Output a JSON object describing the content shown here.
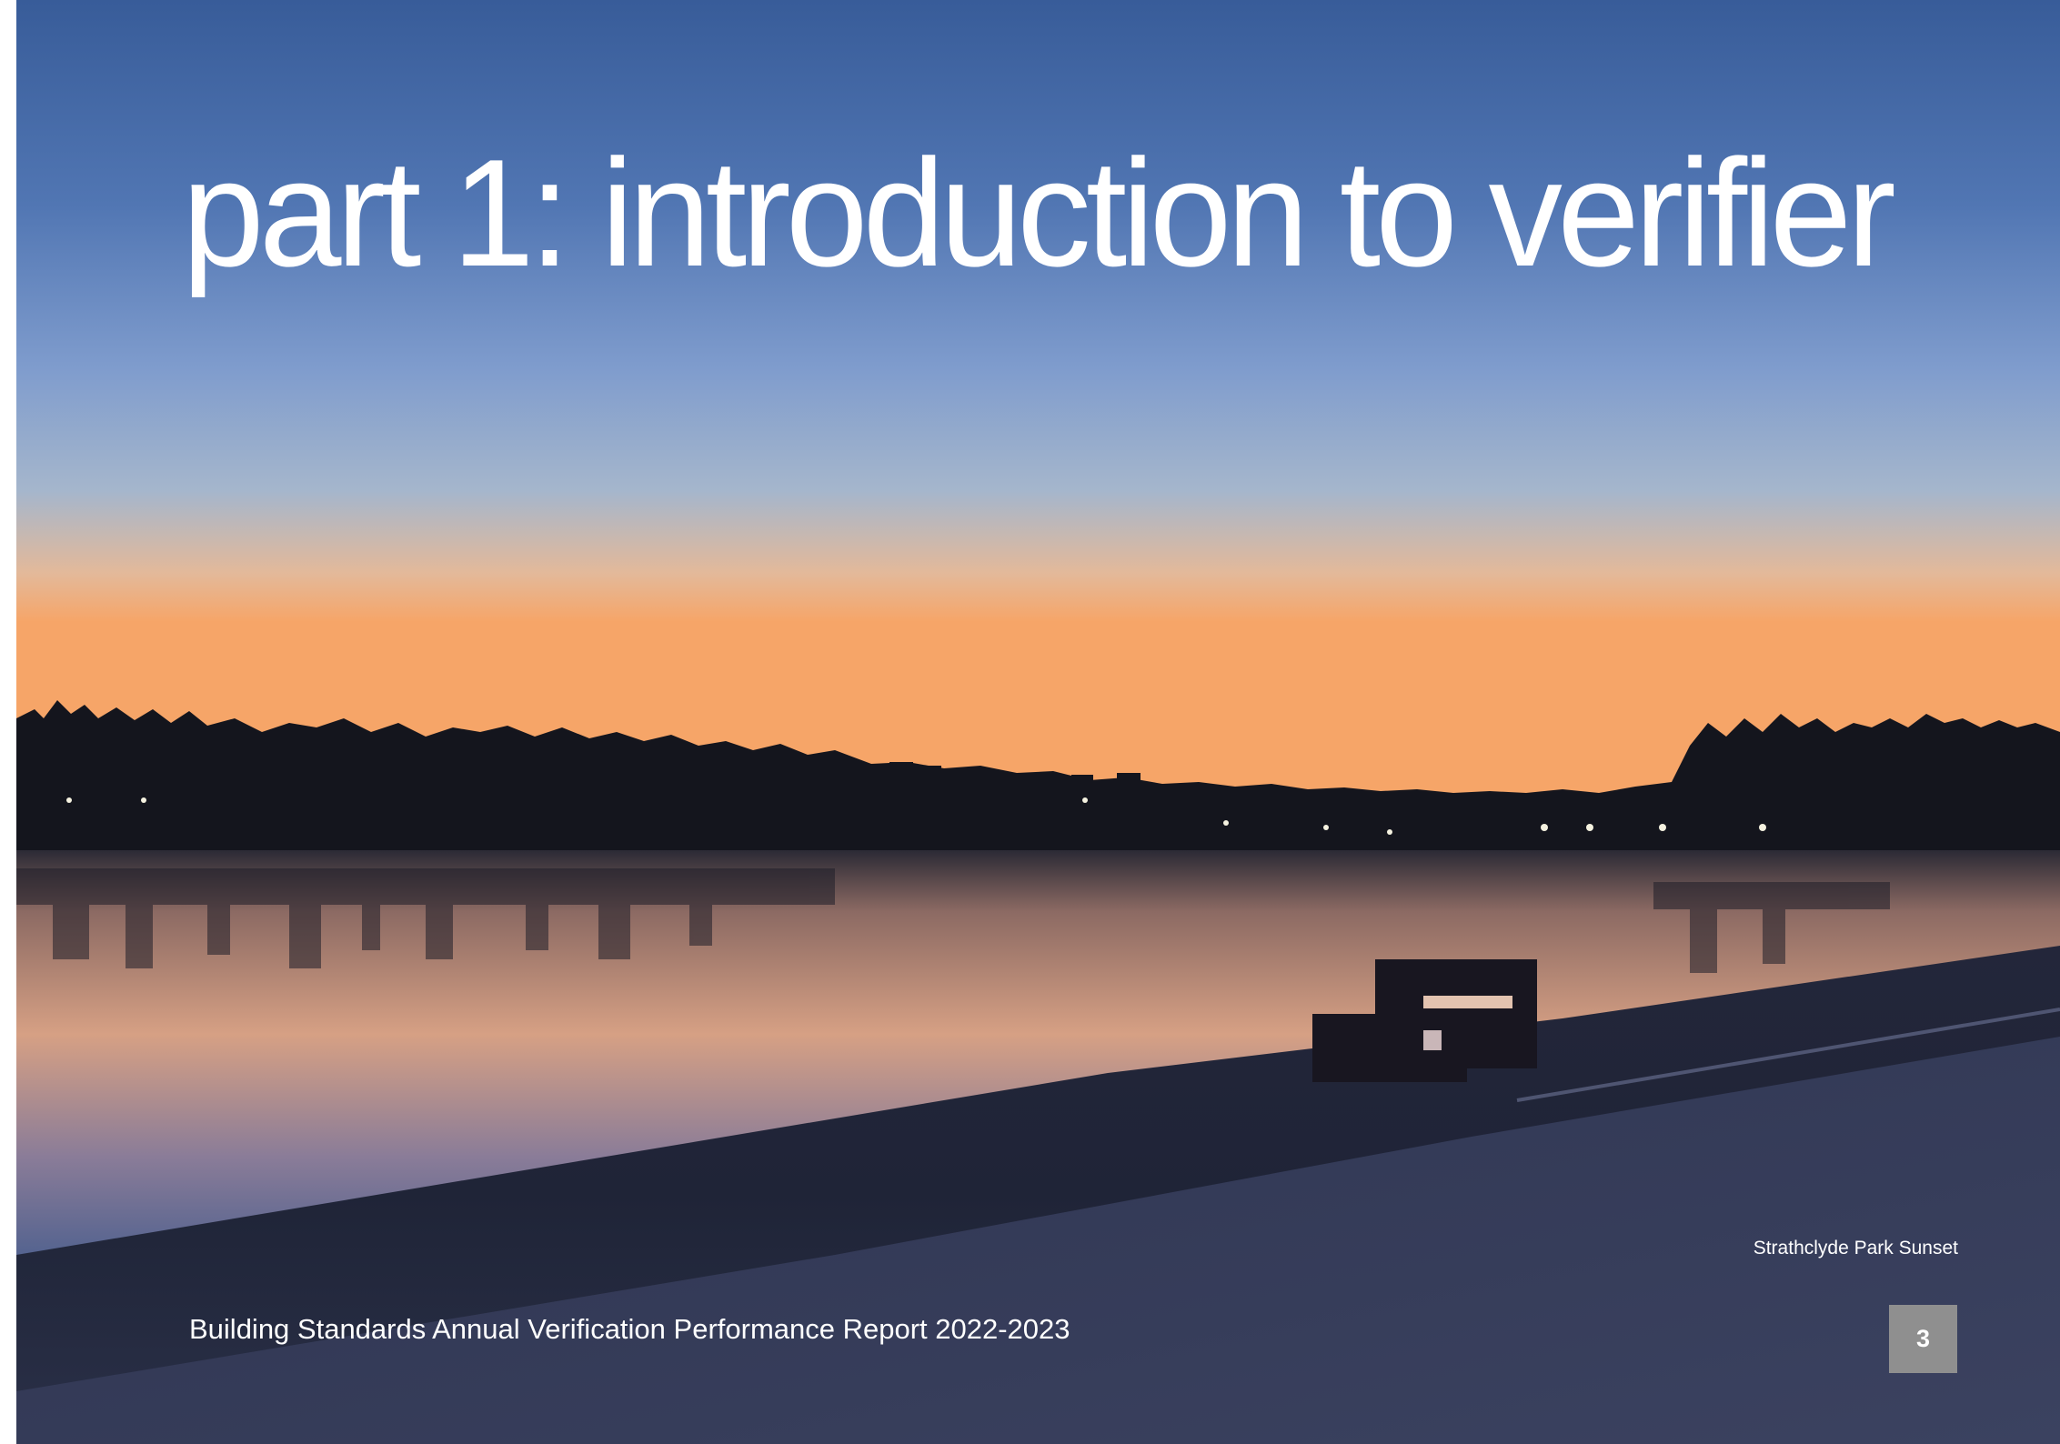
{
  "title": "part 1: introduction to verifier",
  "photo_caption": "Strathclyde Park Sunset",
  "footer_text": "Building Standards Annual Verification Performance Report 2022-2023",
  "page_number": "3",
  "colors": {
    "sky_top": "#3a5f9b",
    "sky_mid": "#8aa8d0",
    "horizon_glow": "#f4a76a",
    "water": "#d9a07f",
    "ground": "#1c2233",
    "page_number_box": "#8f8f8f"
  }
}
